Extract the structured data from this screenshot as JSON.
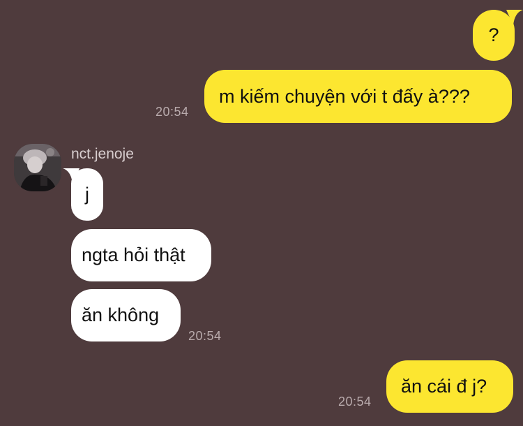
{
  "conversation": {
    "messages_out_top": [
      {
        "text": "?"
      },
      {
        "text": "m kiếm chuyện với t đấy à???",
        "time": "20:54"
      }
    ],
    "contact": {
      "name": "nct.jenoje",
      "avatar_icon": "profile-photo"
    },
    "messages_in": [
      {
        "text": "j"
      },
      {
        "text": "ngta hỏi thật"
      },
      {
        "text": "ăn không",
        "time": "20:54"
      }
    ],
    "messages_out_bottom": [
      {
        "text": "ăn cái đ j?",
        "time": "20:54"
      }
    ]
  },
  "colors": {
    "background": "#4f3b3d",
    "outgoing_bubble": "#fce630",
    "incoming_bubble": "#ffffff",
    "timestamp": "#b9abad",
    "sender_name": "#d9cfd0"
  }
}
